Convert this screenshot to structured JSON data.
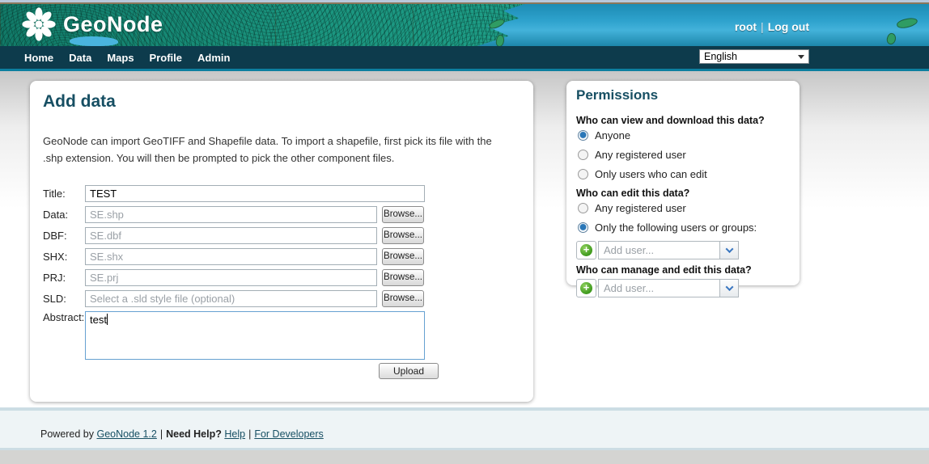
{
  "header": {
    "brand": "GeoNode",
    "user": "root",
    "user_sep": "|",
    "logout_label": "Log out",
    "nav": [
      {
        "label": "Home"
      },
      {
        "label": "Data"
      },
      {
        "label": "Maps"
      },
      {
        "label": "Profile"
      },
      {
        "label": "Admin"
      }
    ],
    "language": {
      "value": "English"
    }
  },
  "main_form": {
    "title": "Add data",
    "description": "GeoNode can import GeoTIFF and Shapefile data. To import a shapefile, first pick its file with the .shp extension. You will then be prompted to pick the other component files.",
    "rows": [
      {
        "label": "Title:",
        "value": "TEST"
      },
      {
        "label": "Data:",
        "placeholder": "SE.shp",
        "browse": "Browse..."
      },
      {
        "label": "DBF:",
        "placeholder": "SE.dbf",
        "browse": "Browse..."
      },
      {
        "label": "SHX:",
        "placeholder": "SE.shx",
        "browse": "Browse..."
      },
      {
        "label": "PRJ:",
        "placeholder": "SE.prj",
        "browse": "Browse..."
      },
      {
        "label": "SLD:",
        "placeholder": "Select a .sld style file (optional)",
        "browse": "Browse..."
      }
    ],
    "abstract_label": "Abstract:",
    "abstract_value": "test",
    "upload_label": "Upload"
  },
  "permissions": {
    "title": "Permissions",
    "view_question": "Who can view and download this data?",
    "view_options": [
      "Anyone",
      "Any registered user",
      "Only users who can edit"
    ],
    "view_selected": "Anyone",
    "edit_question": "Who can edit this data?",
    "edit_options": [
      "Any registered user",
      "Only the following users or groups:"
    ],
    "edit_selected": "Only the following users or groups:",
    "manage_question": "Who can manage and edit this data?",
    "add_user_placeholder": "Add user..."
  },
  "footer": {
    "powered_by": "Powered by",
    "link_geonode": "GeoNode 1.2",
    "sep1": "|",
    "need_help": "Need Help?",
    "link_help": "Help",
    "sep2": "|",
    "link_devs": "For Developers"
  },
  "colors": {
    "navbar": "#0d3b4c",
    "accent_line": "#0c7f9f",
    "heading": "#174f63",
    "land_teal": "#1b957f",
    "ocean_blue": "#2ea2cd",
    "focus_border": "#66a1d1",
    "footer_band": "#eef4f6"
  }
}
